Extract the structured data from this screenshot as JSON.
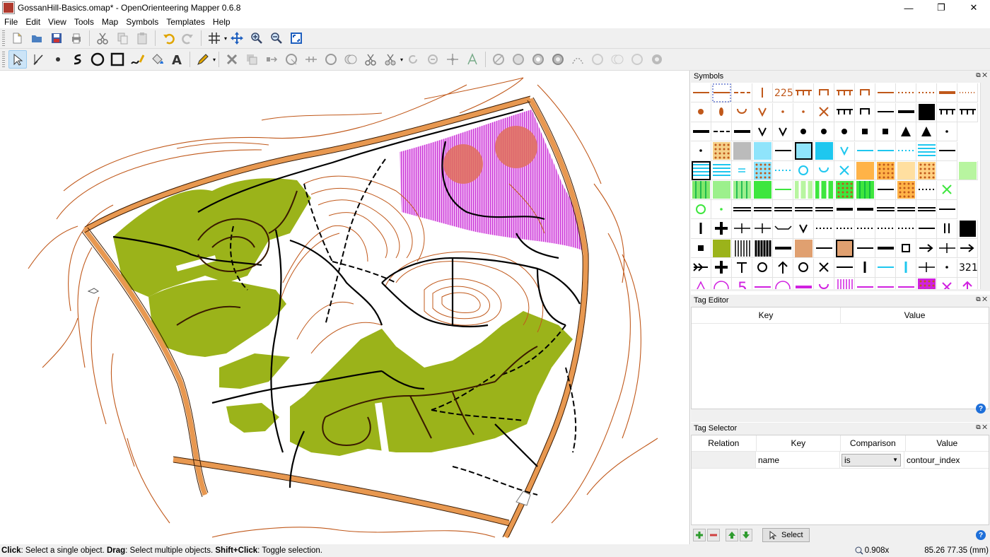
{
  "window": {
    "title": "GossanHill-Basics.omap* - OpenOrienteering Mapper 0.6.8",
    "minimize": "—",
    "maximize": "❐",
    "close": "✕"
  },
  "menu": [
    "File",
    "Edit",
    "View",
    "Tools",
    "Map",
    "Symbols",
    "Templates",
    "Help"
  ],
  "docks": {
    "symbols": {
      "title": "Symbols",
      "labels": [
        "225",
        "321"
      ]
    },
    "tag_editor": {
      "title": "Tag Editor",
      "columns": [
        "Key",
        "Value"
      ]
    },
    "tag_selector": {
      "title": "Tag Selector",
      "columns": [
        "Relation",
        "Key",
        "Comparison",
        "Value"
      ],
      "row": {
        "relation": "",
        "key": "name",
        "comparison": "is",
        "value": "contour_index"
      },
      "select_button": "Select"
    },
    "float_icon": "⧉",
    "close_icon": "✕",
    "help": "?"
  },
  "status": {
    "click_b": "Click",
    "click_t": ": Select a single object. ",
    "drag_b": "Drag",
    "drag_t": ": Select multiple objects. ",
    "shift_b": "Shift+Click",
    "shift_t": ": Toggle selection.",
    "zoom": "0.908x",
    "coords": "85.26 77.35 (mm)"
  },
  "colors": {
    "contour": "#c0581a",
    "forest_green": "#9bb31a",
    "purple_area": "#d64fe0",
    "road": "#e89850",
    "track": "#000000"
  }
}
